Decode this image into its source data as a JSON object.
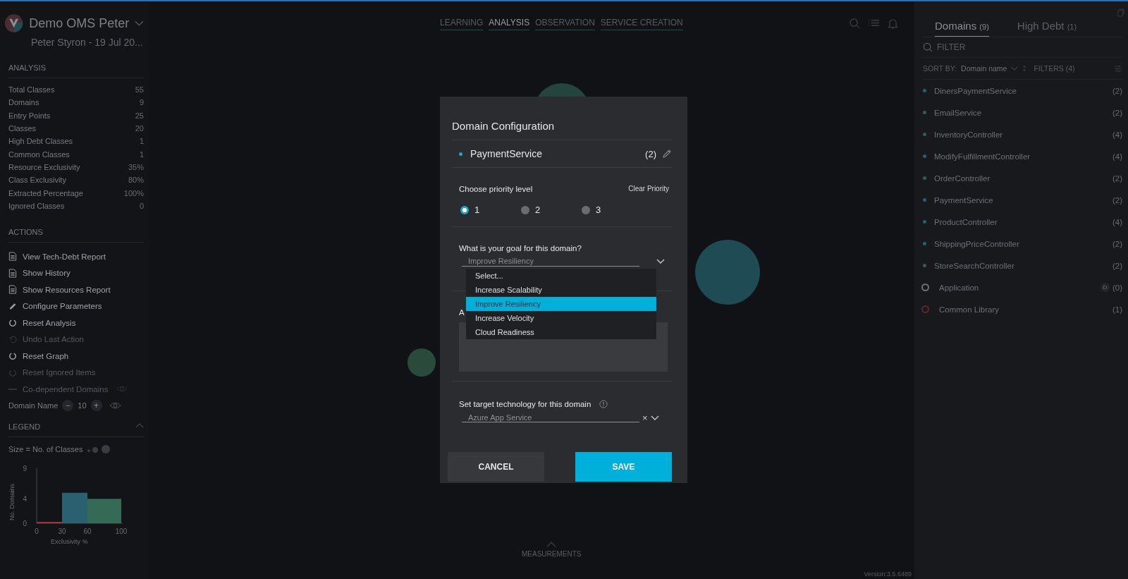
{
  "project": {
    "title": "Demo OMS Peter",
    "subtitle": "Peter Styron - 19 Jul 20..."
  },
  "analysis": {
    "heading": "ANALYSIS",
    "stats": [
      {
        "label": "Total Classes",
        "value": "55"
      },
      {
        "label": "Domains",
        "value": "9"
      },
      {
        "label": "Entry Points",
        "value": "25"
      },
      {
        "label": "Classes",
        "value": "20"
      },
      {
        "label": "High Debt Classes",
        "value": "1"
      },
      {
        "label": "Common Classes",
        "value": "1"
      },
      {
        "label": "Resource Exclusivity",
        "value": "35%"
      },
      {
        "label": "Class Exclusivity",
        "value": "80%"
      },
      {
        "label": "Extracted Percentage",
        "value": "100%"
      },
      {
        "label": "Ignored Classes",
        "value": "0"
      }
    ]
  },
  "actions": {
    "heading": "ACTIONS",
    "items": [
      {
        "label": "View Tech-Debt Report",
        "kind": "report",
        "disabled": false
      },
      {
        "label": "Show History",
        "kind": "report",
        "disabled": false
      },
      {
        "label": "Show Resources Report",
        "kind": "report",
        "disabled": false
      },
      {
        "label": "Configure Parameters",
        "kind": "pencil",
        "disabled": false
      },
      {
        "label": "Reset Analysis",
        "kind": "reset",
        "disabled": false
      },
      {
        "label": "Undo Last Action",
        "kind": "undo",
        "disabled": true
      },
      {
        "label": "Reset Graph",
        "kind": "reset",
        "disabled": false
      },
      {
        "label": "Reset Ignored Items",
        "kind": "reset",
        "disabled": true
      },
      {
        "label": "Co-dependent Domains",
        "kind": "toggle",
        "disabled": true
      }
    ]
  },
  "domain_name": {
    "label": "Domain Name",
    "minus": "−",
    "value": "10",
    "plus": "+"
  },
  "legend": {
    "heading": "LEGEND",
    "size_label": "Size = No. of Classes",
    "chart_data": {
      "type": "bar",
      "xlabel": "Exclusivity %",
      "ylabel": "No. Domains",
      "x": [
        15,
        45,
        80
      ],
      "series": [
        {
          "color": "#a0333b",
          "values": [
            0,
            null,
            null
          ]
        },
        {
          "color": "#2a6070",
          "values": [
            null,
            5,
            null
          ]
        },
        {
          "color": "#356a57",
          "values": [
            null,
            null,
            4
          ]
        }
      ],
      "xlim": [
        0,
        100
      ],
      "ylim": [
        0,
        9
      ],
      "yticks": [
        0,
        4,
        9
      ],
      "xticks": [
        0,
        30,
        60,
        100
      ]
    }
  },
  "nav_tabs": [
    {
      "label": "LEARNING",
      "selected": false
    },
    {
      "label": "ANALYSIS",
      "selected": true
    },
    {
      "label": "OBSERVATION",
      "selected": false
    },
    {
      "label": "SERVICE CREATION",
      "selected": false
    }
  ],
  "measurements": {
    "label": "MEASUREMENTS"
  },
  "version": "Version:3.5.6489",
  "right_panel": {
    "tabs": [
      {
        "label": "Domains",
        "count": "(9)",
        "selected": true
      },
      {
        "label": "High Debt",
        "count": "(1)",
        "selected": false
      }
    ],
    "filter": {
      "placeholder": "FILTER"
    },
    "sort": {
      "label": "SORT BY:",
      "value": "Domain name",
      "filters": "FILTERS (4)"
    },
    "items": [
      {
        "name": "DinersPaymentService",
        "count": "(2)",
        "kind": "dot",
        "color": "#2a5f6c"
      },
      {
        "name": "EmailService",
        "count": "(2)",
        "kind": "dot",
        "color": "#365c4e"
      },
      {
        "name": "InventoryController",
        "count": "(4)",
        "kind": "dot",
        "color": "#365c4e"
      },
      {
        "name": "ModifyFulfillmentController",
        "count": "(4)",
        "kind": "dot",
        "color": "#2a5f6c"
      },
      {
        "name": "OrderController",
        "count": "(2)",
        "kind": "dot",
        "color": "#365c4e"
      },
      {
        "name": "PaymentService",
        "count": "(2)",
        "kind": "dot",
        "color": "#2a5f6c"
      },
      {
        "name": "ProductController",
        "count": "(4)",
        "kind": "dot",
        "color": "#2a5f6c"
      },
      {
        "name": "ShippingPriceController",
        "count": "(2)",
        "kind": "dot",
        "color": "#2a5f6c"
      },
      {
        "name": "StoreSearchController",
        "count": "(2)",
        "kind": "dot",
        "color": "#365c4e"
      },
      {
        "name": "Application",
        "count": "(0)",
        "kind": "ring",
        "color": "#6e7076",
        "badge": "D"
      },
      {
        "name": "Common Library",
        "count": "(1)",
        "kind": "ring",
        "color": "#5e262b"
      }
    ]
  },
  "dialog": {
    "title": "Domain Configuration",
    "domain": {
      "name": "PaymentService",
      "count": "(2)",
      "color": "#2a9fc8"
    },
    "priority": {
      "label": "Choose priority level",
      "clear": "Clear Priority",
      "options": [
        {
          "label": "1",
          "selected": true
        },
        {
          "label": "2",
          "selected": false
        },
        {
          "label": "3",
          "selected": false
        }
      ]
    },
    "goal": {
      "label": "What is your goal for this domain?",
      "value": "Improve Resiliency",
      "options": [
        {
          "label": "Select...",
          "selected": false
        },
        {
          "label": "Increase Scalability",
          "selected": false
        },
        {
          "label": "Improve Resiliency",
          "selected": true
        },
        {
          "label": "Increase Velocity",
          "selected": false
        },
        {
          "label": "Cloud Readiness",
          "selected": false
        }
      ]
    },
    "notes": {
      "label": "A"
    },
    "target": {
      "label": "Set target technology for this domain",
      "value": "Azure App Service",
      "clear": "×"
    },
    "buttons": {
      "cancel": "CANCEL",
      "save": "SAVE"
    }
  }
}
